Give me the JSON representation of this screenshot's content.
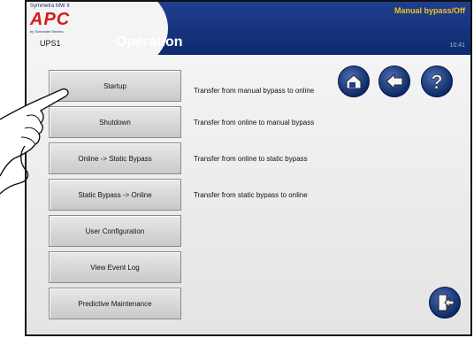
{
  "header": {
    "brand_top": "Symmetra MW II",
    "brand_logo": "APC",
    "brand_by": "by Schneider Electric",
    "device_name": "UPS1",
    "page_title": "Operation",
    "mode_status": "Manual bypass/Off",
    "clock": "10:41"
  },
  "menu": [
    {
      "label": "Startup",
      "description": "Transfer from manual bypass to online"
    },
    {
      "label": "Shutdown",
      "description": "Transfer from online to manual bypass"
    },
    {
      "label": "Online -> Static Bypass",
      "description": "Transfer from online to static bypass"
    },
    {
      "label": "Static Bypass -> Online",
      "description": "Transfer from static bypass to online"
    },
    {
      "label": "User Configuration",
      "description": ""
    },
    {
      "label": "View Event Log",
      "description": ""
    },
    {
      "label": "Predictive Maintenance",
      "description": ""
    }
  ],
  "nav_icons": [
    "home-icon",
    "back-arrow-icon",
    "help-icon",
    "logout-icon"
  ],
  "colors": {
    "header_bg": "#1f3f8f",
    "mode_text": "#f2c21a",
    "brand_red": "#d41c1c"
  }
}
